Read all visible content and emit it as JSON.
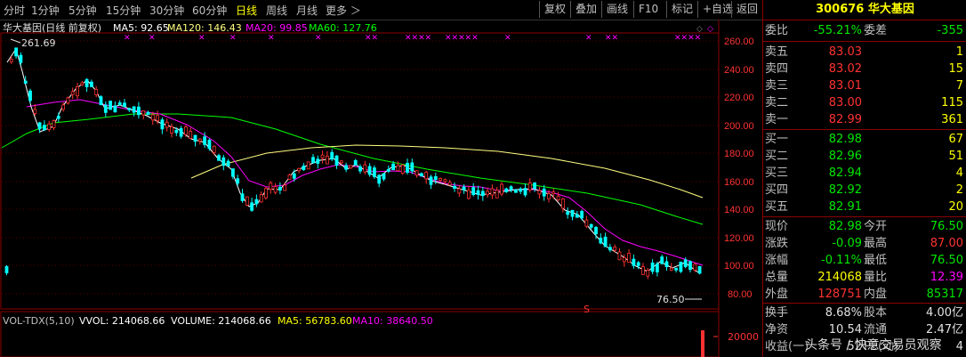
{
  "toolbar": {
    "tabs": [
      "分时",
      "1分钟",
      "5分钟",
      "15分钟",
      "30分钟",
      "60分钟",
      "日线",
      "周线",
      "月线",
      "更多 ＞"
    ],
    "active": "日线",
    "buttons": [
      "复权",
      "叠加",
      "画线",
      "F10",
      "标记",
      "+自选",
      "返回"
    ]
  },
  "chart": {
    "title": "华大基因(日线 前复权)",
    "ma5": "MA5: 92.65",
    "ma120": "MA120: 146.43",
    "ma20": "MA20: 99.85",
    "ma60": "MA60: 127.76",
    "high_label": "261.69",
    "low_label": "76.50",
    "price_axis": [
      "260.00",
      "240.00",
      "220.00",
      "200.00",
      "180.00",
      "160.00",
      "140.00",
      "120.00",
      "100.00",
      "80.00"
    ],
    "vol_title": "VOL-TDX(5,10)",
    "vvol": "VVOL: 214068.66",
    "volume": "VOLUME: 214068.66",
    "vma5": "MA5: 56783.60",
    "vma10": "MA10: 38640.50",
    "vol_axis": "20000",
    "s_marker": "S",
    "colors": {
      "up": "#ff3232",
      "down": "#00ffff",
      "ma5": "#ffffff",
      "ma20": "#ff00ff",
      "ma60": "#00ff00",
      "ma120": "#ffff80"
    }
  },
  "panel": {
    "code": "300676",
    "name": "华大基因",
    "weibi_label": "委比",
    "weibi": "-55.21%",
    "weicha_label": "委差",
    "weicha": "-355",
    "asks": [
      {
        "label": "卖五",
        "price": "83.03",
        "vol": "1"
      },
      {
        "label": "卖四",
        "price": "83.02",
        "vol": "15"
      },
      {
        "label": "卖三",
        "price": "83.01",
        "vol": "7"
      },
      {
        "label": "卖二",
        "price": "83.00",
        "vol": "115"
      },
      {
        "label": "卖一",
        "price": "82.99",
        "vol": "361"
      }
    ],
    "bids": [
      {
        "label": "买一",
        "price": "82.98",
        "vol": "67"
      },
      {
        "label": "买二",
        "price": "82.96",
        "vol": "51"
      },
      {
        "label": "买三",
        "price": "82.94",
        "vol": "4"
      },
      {
        "label": "买四",
        "price": "82.92",
        "vol": "2"
      },
      {
        "label": "买五",
        "price": "82.91",
        "vol": "20"
      }
    ],
    "stats": [
      {
        "l1": "现价",
        "v1": "82.98",
        "l2": "今开",
        "v2": "76.50"
      },
      {
        "l1": "涨跌",
        "v1": "-0.09",
        "l2": "最高",
        "v2": "87.00"
      },
      {
        "l1": "涨幅",
        "v1": "-0.11%",
        "l2": "最低",
        "v2": "76.50"
      },
      {
        "l1": "总量",
        "v1": "214068",
        "l2": "量比",
        "v2": "12.39"
      },
      {
        "l1": "外盘",
        "v1": "128751",
        "l2": "内盘",
        "v2": "85317"
      }
    ],
    "stats2": [
      {
        "l1": "换手",
        "v1": "8.68%",
        "l2": "股本",
        "v2": "4.00亿"
      },
      {
        "l1": "净资",
        "v1": "10.54",
        "l2": "流通",
        "v2": "2.47亿"
      },
      {
        "l1": "收益(一)",
        "v1": "52",
        "l2": "PE(动)",
        "v2": "4"
      }
    ],
    "watermark": "头条号 / 快意交易员观察"
  }
}
